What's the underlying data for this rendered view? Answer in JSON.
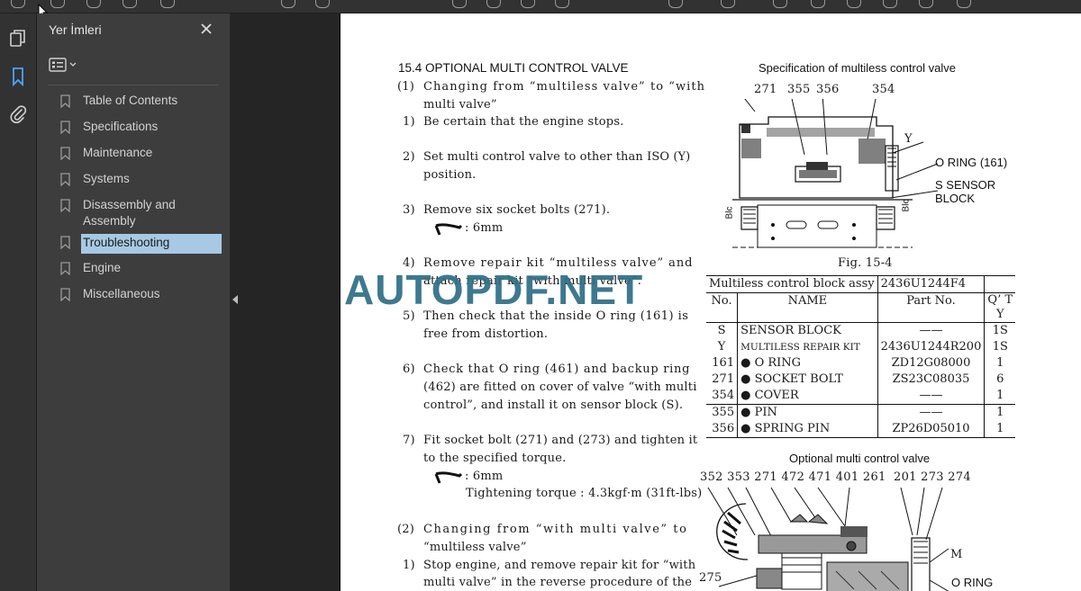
{
  "sidebar": {
    "title": "Yer İmleri",
    "close_icon": "close-icon",
    "options_icon": "bookmark-options-icon",
    "items": [
      {
        "label": "Table of Contents"
      },
      {
        "label": "Specifications"
      },
      {
        "label": "Maintenance"
      },
      {
        "label": "Systems"
      },
      {
        "label": "Disassembly and Assembly"
      },
      {
        "label": "Troubleshooting",
        "selected": true
      },
      {
        "label": "Engine"
      },
      {
        "label": "Miscellaneous"
      }
    ]
  },
  "rail": {
    "icons": [
      "pages-icon",
      "bookmark-icon",
      "attachment-icon"
    ]
  },
  "document": {
    "heading": "15.4   OPTIONAL MULTI CONTROL VALVE",
    "lines": [
      {
        "n": "(1)",
        "text": "Changing from “multiless valve” to “with"
      },
      {
        "n": "",
        "text": "multi valve”"
      },
      {
        "n": "1)",
        "text": "Be certain that the engine stops."
      },
      {
        "n": "2)",
        "text": "Set multi control valve to other than ISO (Y)"
      },
      {
        "n": "",
        "text": "position."
      },
      {
        "n": "3)",
        "text": "Remove six socket bolts (271)."
      },
      {
        "n": "",
        "text": ": 6mm"
      },
      {
        "n": "4)",
        "text": "Remove repair kit “multiless valve” and"
      },
      {
        "n": "",
        "text": "attach repair kit “with multi valve”."
      },
      {
        "n": "5)",
        "text": "Then check that the inside O ring (161) is"
      },
      {
        "n": "",
        "text": "free from distortion."
      },
      {
        "n": "6)",
        "text": "Check that O ring (461) and backup ring"
      },
      {
        "n": "",
        "text": "(462) are fitted on cover of valve “with multi"
      },
      {
        "n": "",
        "text": "control”, and install it on sensor block (S)."
      },
      {
        "n": "7)",
        "text": "Fit socket bolt (271) and (273) and tighten it"
      },
      {
        "n": "",
        "text": "to the specified torque."
      },
      {
        "n": "",
        "text": ": 6mm"
      },
      {
        "n": "",
        "text": "Tightening torque : 4.3kgf·m (31ft-lbs)"
      },
      {
        "n": "(2)",
        "text": "Changing from “with multi valve” to"
      },
      {
        "n": "",
        "text": "“multiless valve”"
      },
      {
        "n": "1)",
        "text": "Stop engine, and remove repair kit for “with"
      },
      {
        "n": "",
        "text": "multi valve” in the reverse procedure of the"
      }
    ],
    "watermark": "AUTOPDF.NET",
    "fig1": {
      "title": "Specification of multiless control valve",
      "labels": [
        "271",
        "355",
        "356",
        "354",
        "Y",
        "O RING (161)",
        "S SENSOR",
        "BLOCK",
        "Blc",
        "Blc"
      ],
      "caption": "Fig. 15-4"
    },
    "table": {
      "title": [
        "Multiless control block assy",
        "2436U1244F4"
      ],
      "headers": [
        "No.",
        "NAME",
        "Part No.",
        "Q’ T",
        "Y"
      ],
      "rows": [
        [
          "S",
          "SENSOR BLOCK",
          "——",
          "1S"
        ],
        [
          "Y",
          "MULTILESS REPAIR KIT",
          "2436U1244R200",
          "1S"
        ],
        [
          "161",
          "● O RING",
          "ZD12G08000",
          "1"
        ],
        [
          "271",
          "● SOCKET BOLT",
          "ZS23C08035",
          "6"
        ],
        [
          "354",
          "● COVER",
          "——",
          "1"
        ],
        [
          "355",
          "● PIN",
          "——",
          "1"
        ],
        [
          "356",
          "● SPRING PIN",
          "ZP26D05010",
          "1"
        ]
      ]
    },
    "fig2": {
      "title": "Optional multi control valve",
      "labels_top": "352 353 271 472 471 401   261",
      "labels_right": "201 273 274",
      "label_m": "M",
      "label_275": "275",
      "label_oring": "O RING"
    }
  }
}
